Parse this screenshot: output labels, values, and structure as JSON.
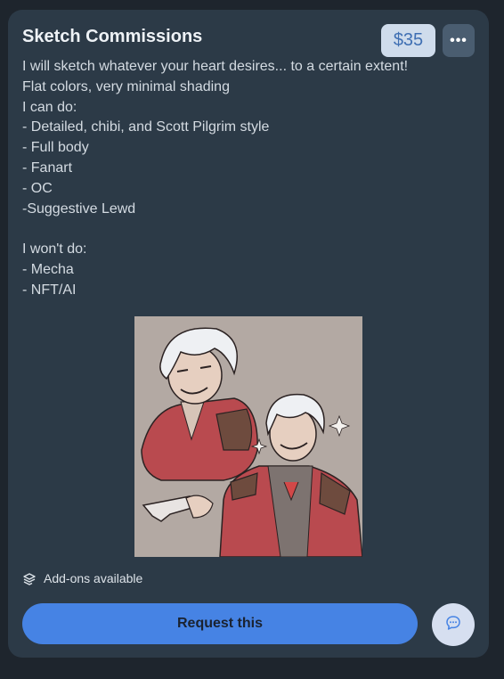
{
  "listing": {
    "title": "Sketch Commissions",
    "price": "$35",
    "description_lines": [
      "I will sketch whatever your heart desires... to a certain extent!",
      "Flat colors, very minimal shading",
      "I can do:",
      "- Detailed, chibi, and Scott Pilgrim style",
      "- Full body",
      "- Fanart",
      "- OC",
      "-Suggestive Lewd",
      "",
      "I won't do:",
      "- Mecha",
      "- NFT/AI"
    ],
    "artwork_icon": "sketch-artwork",
    "addons_label": "Add-ons available",
    "request_label": "Request this"
  },
  "icons": {
    "more": "more-horizontal-icon",
    "addons": "layers-plus-icon",
    "chat": "chat-bubble-icon"
  },
  "colors": {
    "background": "#1e252d",
    "card": "#2c3a47",
    "price_bg": "#cfdcec",
    "price_text": "#3f6fb3",
    "accent": "#4683e4"
  }
}
